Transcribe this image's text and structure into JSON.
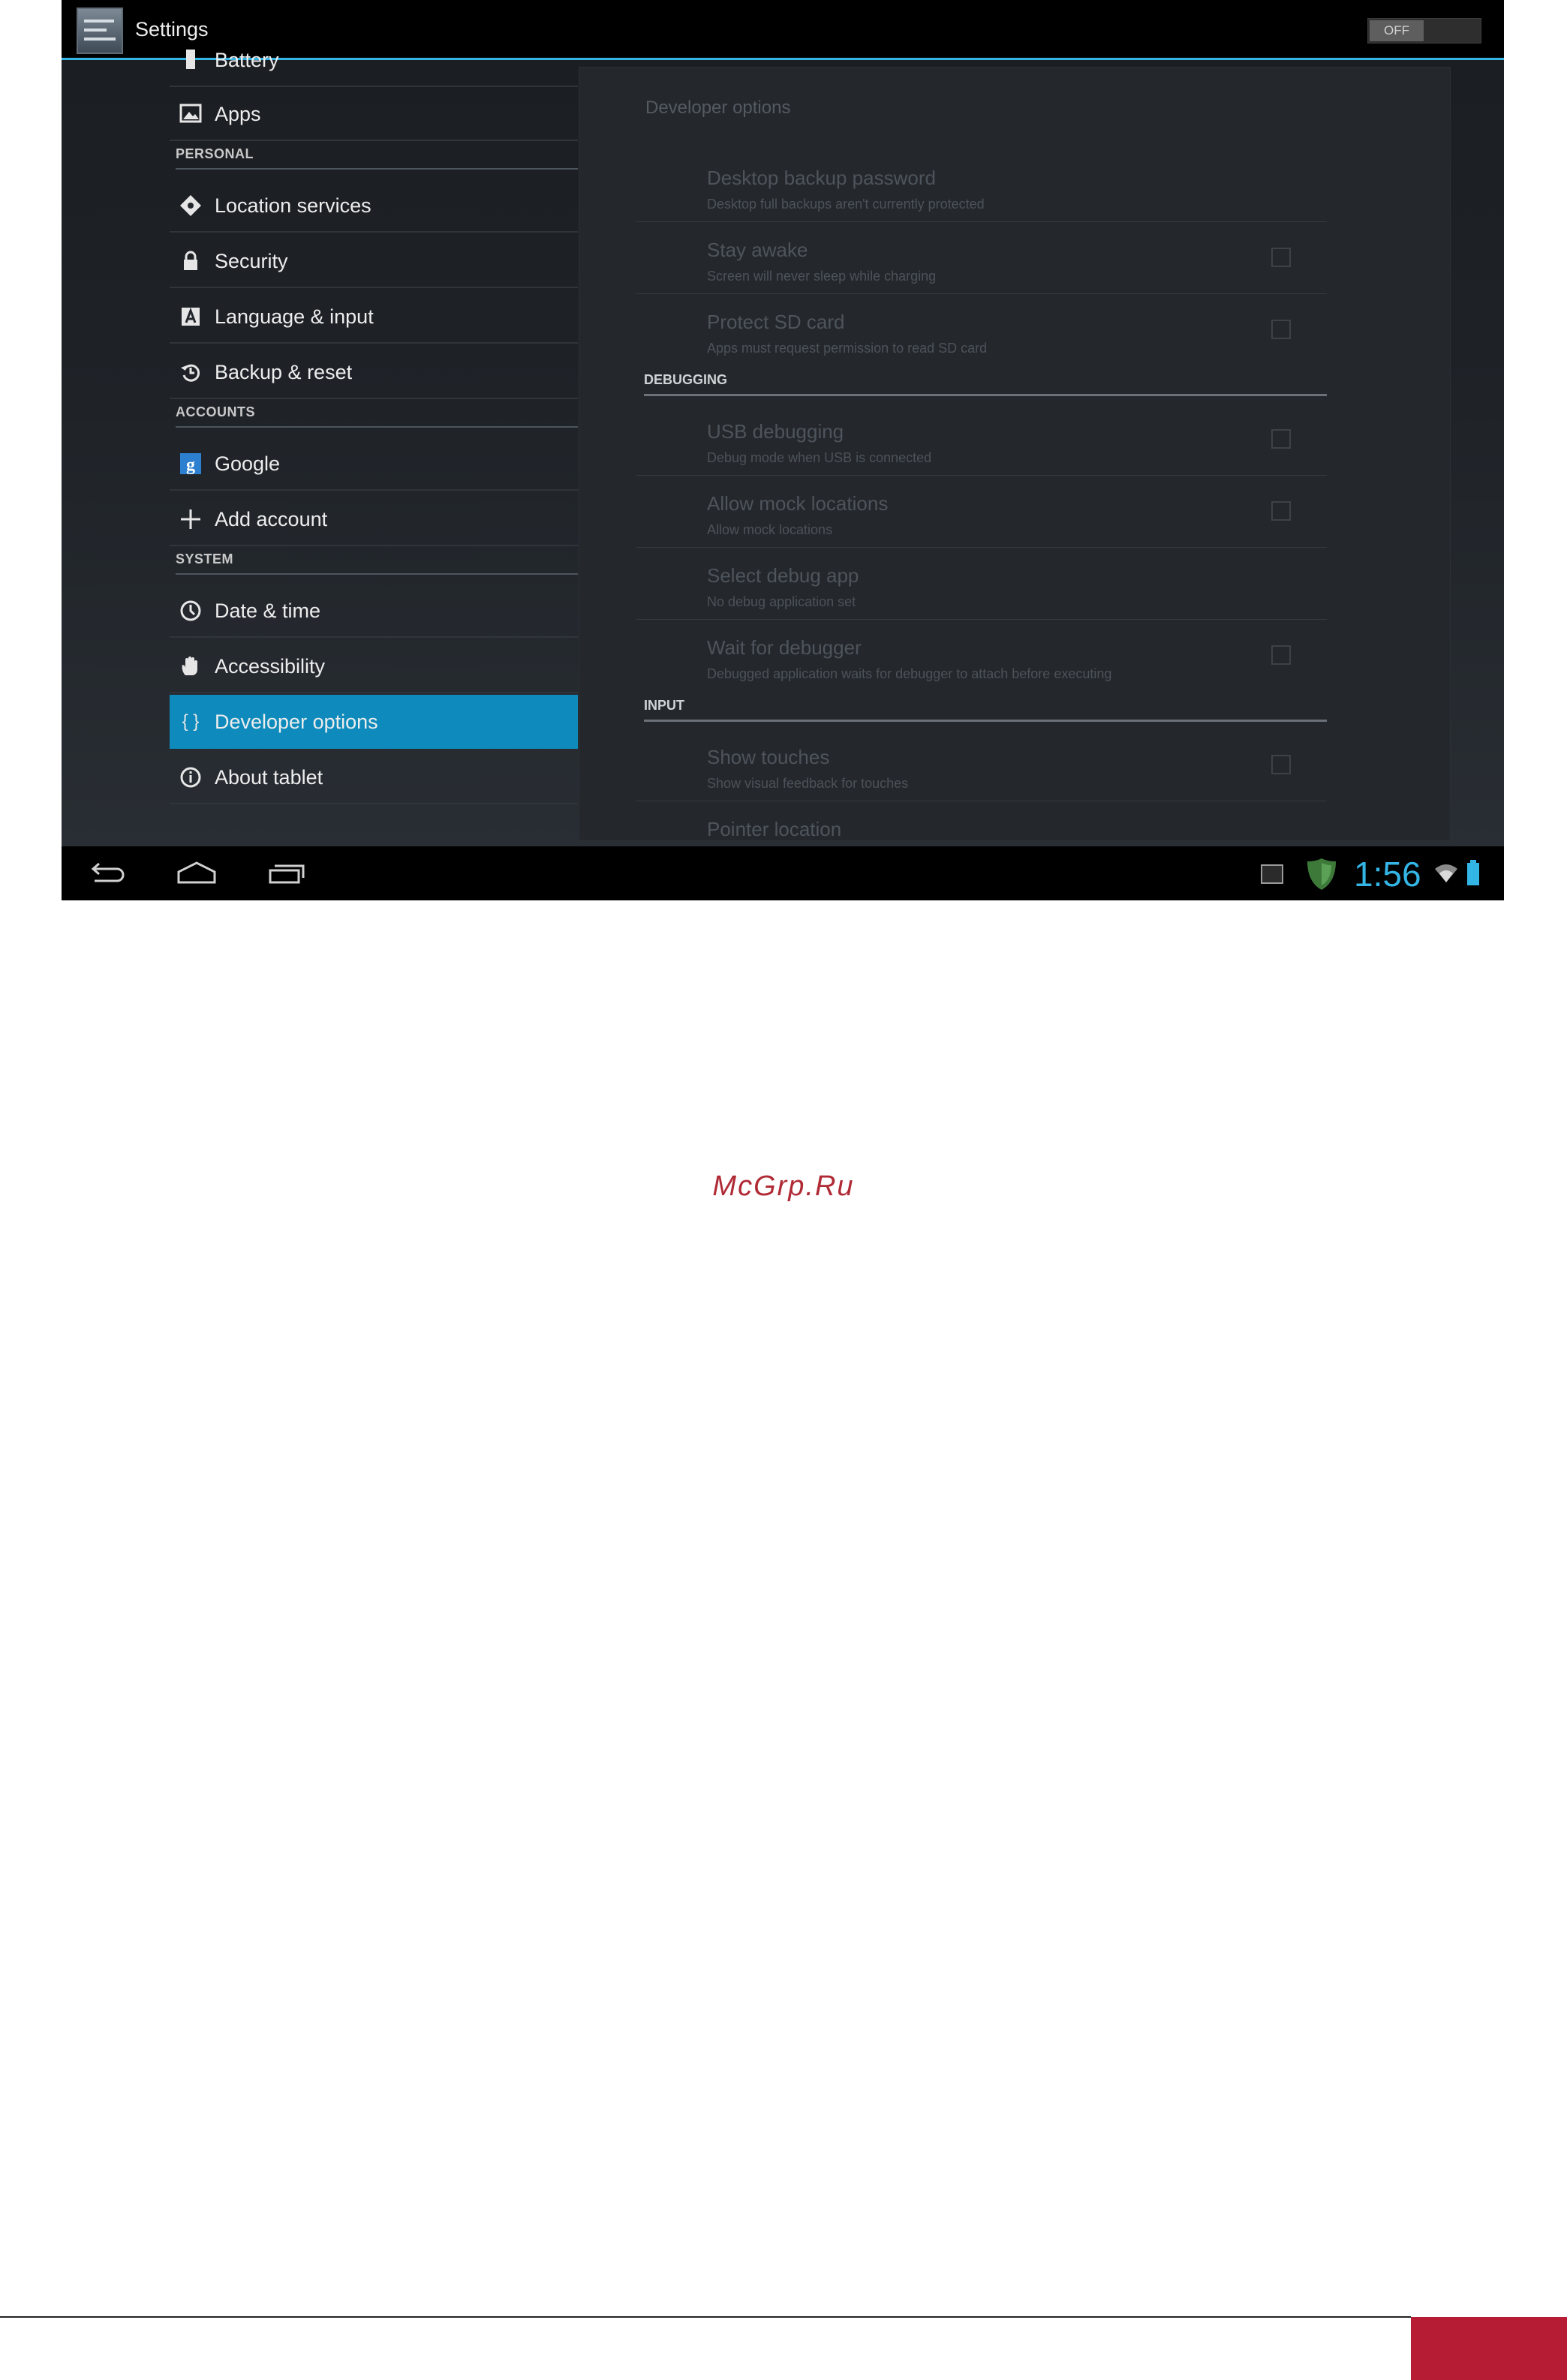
{
  "actionbar": {
    "title": "Settings",
    "master_switch": "OFF",
    "app_icon": "settings-icon"
  },
  "sidebar": {
    "items": [
      {
        "label": "Battery",
        "icon": "battery-icon",
        "selected": false
      },
      {
        "label": "Apps",
        "icon": "apps-icon",
        "selected": false
      },
      {
        "header": "PERSONAL"
      },
      {
        "label": "Location services",
        "icon": "location-icon",
        "selected": false
      },
      {
        "label": "Security",
        "icon": "lock-icon",
        "selected": false
      },
      {
        "label": "Language & input",
        "icon": "language-icon",
        "selected": false
      },
      {
        "label": "Backup & reset",
        "icon": "backup-icon",
        "selected": false
      },
      {
        "header": "ACCOUNTS"
      },
      {
        "label": "Google",
        "icon": "google-icon",
        "selected": false
      },
      {
        "label": "Add account",
        "icon": "plus-icon",
        "selected": false
      },
      {
        "header": "SYSTEM"
      },
      {
        "label": "Date & time",
        "icon": "clock-icon",
        "selected": false
      },
      {
        "label": "Accessibility",
        "icon": "hand-icon",
        "selected": false
      },
      {
        "label": "Developer options",
        "icon": "braces-icon",
        "selected": true
      },
      {
        "label": "About tablet",
        "icon": "info-icon",
        "selected": false
      }
    ]
  },
  "detail": {
    "title": "Developer options",
    "prefs": [
      {
        "title": "Desktop backup password",
        "summary": "Desktop full backups aren't currently protected"
      },
      {
        "title": "Stay awake",
        "summary": "Screen will never sleep while charging"
      },
      {
        "title": "Protect SD card",
        "summary": "Apps must request permission to read SD card"
      }
    ],
    "debugging_header": "DEBUGGING",
    "debugging": [
      {
        "title": "USB debugging",
        "summary": "Debug mode when USB is connected"
      },
      {
        "title": "Allow mock locations",
        "summary": "Allow mock locations"
      },
      {
        "title": "Select debug app",
        "summary": "No debug application set"
      },
      {
        "title": "Wait for debugger",
        "summary": "Debugged application waits for debugger to attach before executing"
      }
    ],
    "input_header": "INPUT",
    "input": [
      {
        "title": "Show touches",
        "summary": "Show visual feedback for touches"
      },
      {
        "title": "Pointer location",
        "summary": ""
      }
    ]
  },
  "statusbar": {
    "time": "1:56"
  },
  "page": {
    "watermark": "McGrp.Ru"
  },
  "colors": {
    "accent": "#33b5e5",
    "selected": "#0e8bbc",
    "brand": "#b71c35"
  }
}
